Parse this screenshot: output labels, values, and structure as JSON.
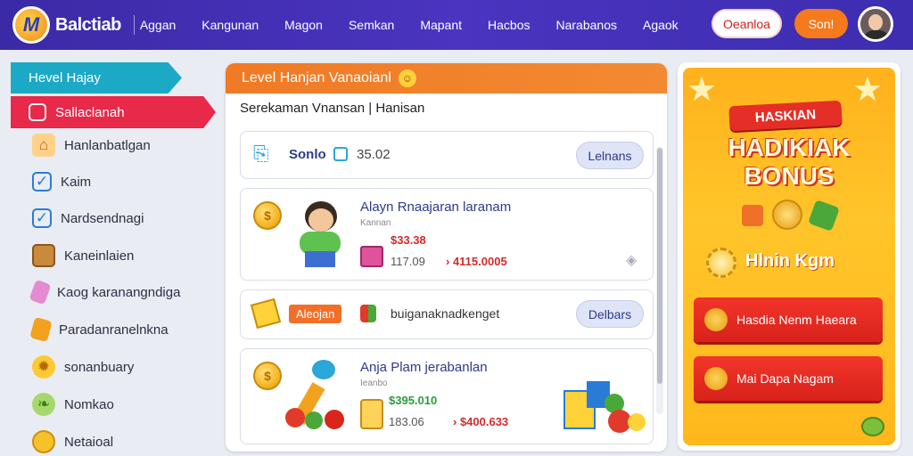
{
  "header": {
    "logo_text": "Balctiab",
    "logo_letter": "M",
    "nav": [
      "Aggan",
      "Kangunan",
      "Magon",
      "Semkan",
      "Mapant",
      "Hacbos",
      "Narabanos",
      "Agaok"
    ],
    "btn_outline": "Oeanloa",
    "btn_primary": "Son!"
  },
  "sidebar": {
    "header": "Hevel Hajay",
    "active": "Sallaclanah",
    "items": [
      {
        "label": "Hanlanbatlgan",
        "icon": "house-icon"
      },
      {
        "label": "Kaim",
        "icon": "checkbox-icon"
      },
      {
        "label": "Nardsendnagi",
        "icon": "checkbox-icon"
      },
      {
        "label": "Kaneinlaien",
        "icon": "barrel-icon"
      },
      {
        "label": "Kaog karanangndiga",
        "icon": "tag-icon"
      },
      {
        "label": "Paradanranelnkna",
        "icon": "tag-icon"
      },
      {
        "label": "sonanbuary",
        "icon": "gear-icon"
      },
      {
        "label": "Nomkao",
        "icon": "leaf-icon"
      },
      {
        "label": "Netaioal",
        "icon": "coin-icon"
      }
    ]
  },
  "main": {
    "title": "Level Hanjan Vanaoianl",
    "tabs": "Serekaman  Vnansan  |  Hanisan",
    "row1": {
      "label": "Sonlo",
      "value": "35.02",
      "button": "Lelnans"
    },
    "row2": {
      "title": "Alayn Rnaajaran laranam",
      "subtitle": "Kannan",
      "price_red": "$33.38",
      "qty": "117.09",
      "total": "› 4115.0005"
    },
    "row3": {
      "badge": "Aleojan",
      "text": "buiganaknadkenget",
      "button": "Delbars"
    },
    "row4": {
      "title": "Anja Plam jerabanlan",
      "subtitle": "Ieanbo",
      "price_green": "$395.010",
      "qty": "183.06",
      "total": "› $400.633"
    }
  },
  "promo": {
    "ribbon": "HASKIAN",
    "title_line1": "HADIKIAK",
    "title_line2": "BONUS",
    "feature": "Hlnin Kgm",
    "btn1": "Hasdia Nenm Haeara",
    "btn2": "Mai Dapa Nagam"
  },
  "colors": {
    "accent": "#4a34c0",
    "orange": "#f07a25",
    "red": "#e8294a",
    "teal": "#1ba9c5"
  }
}
